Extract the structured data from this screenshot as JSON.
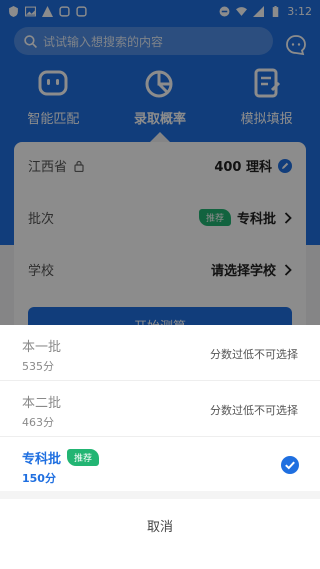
{
  "statusbar": {
    "time": "3:12",
    "left_icons": [
      "shield-icon",
      "image-icon",
      "warning-icon",
      "app-icon",
      "app-icon"
    ],
    "right_icons": [
      "minus-circle-icon",
      "wifi-icon",
      "signal-icon",
      "battery-icon"
    ]
  },
  "search": {
    "placeholder": "试试输入想搜索的内容"
  },
  "tabs": [
    {
      "label": "智能匹配",
      "icon": "robot-icon",
      "active": false
    },
    {
      "label": "录取概率",
      "icon": "pie-chart-icon",
      "active": true
    },
    {
      "label": "模拟填报",
      "icon": "document-edit-icon",
      "active": false
    }
  ],
  "form": {
    "province": "江西省",
    "score_subject": "400 理科",
    "batch_label": "批次",
    "batch_badge": "推荐",
    "batch_value": "专科批",
    "school_label": "学校",
    "school_value": "请选择学校",
    "start_button": "开始测算"
  },
  "sheet": {
    "options": [
      {
        "title": "本一批",
        "score": "535分",
        "status": "分数过低不可选择",
        "selected": false
      },
      {
        "title": "本二批",
        "score": "463分",
        "status": "分数过低不可选择",
        "selected": false
      },
      {
        "title": "专科批",
        "badge": "推荐",
        "score": "150分",
        "selected": true
      }
    ],
    "cancel": "取消"
  },
  "colors": {
    "primary": "#1f6fe0",
    "badge_green": "#22b573"
  }
}
